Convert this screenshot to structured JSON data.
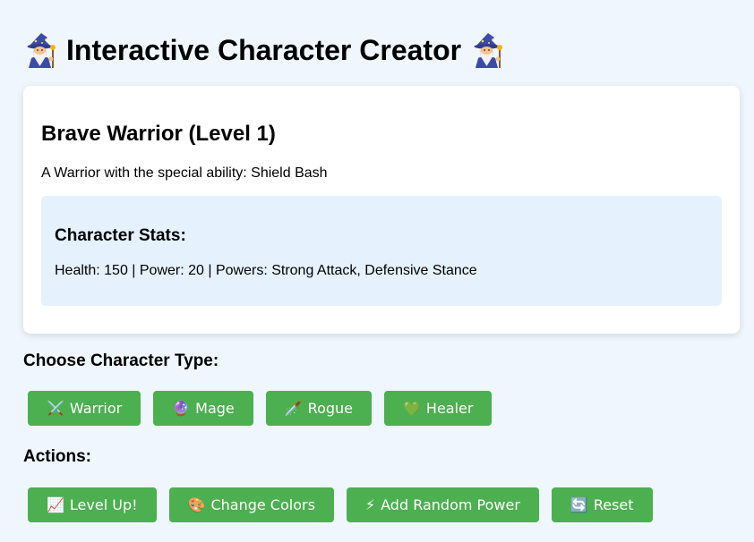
{
  "header": {
    "title": "Interactive Character Creator",
    "left_icon": "wizard-icon",
    "right_icon": "wizard-icon"
  },
  "character": {
    "name": "Brave Warrior (Level 1)",
    "description": "A Warrior with the special ability: Shield Bash",
    "stats_title": "Character Stats:",
    "stats_line": "Health: 150 | Power: 20 | Powers: Strong Attack, Defensive Stance"
  },
  "type_section": {
    "heading": "Choose Character Type:",
    "buttons": [
      {
        "icon": "⚔️",
        "label": "Warrior"
      },
      {
        "icon": "🔮",
        "label": "Mage"
      },
      {
        "icon": "🗡️",
        "label": "Rogue"
      },
      {
        "icon": "💚",
        "label": "Healer"
      }
    ]
  },
  "actions_section": {
    "heading": "Actions:",
    "buttons": [
      {
        "icon": "📈",
        "label": "Level Up!"
      },
      {
        "icon": "🎨",
        "label": "Change Colors"
      },
      {
        "icon": "⚡",
        "label": "Add Random Power"
      },
      {
        "icon": "🔄",
        "label": "Reset"
      }
    ]
  },
  "colors": {
    "page_background": "#eff6fd",
    "card_background": "#ffffff",
    "stats_background": "#e5f1fd",
    "button_background": "#4caf50",
    "button_text": "#ffffff"
  }
}
